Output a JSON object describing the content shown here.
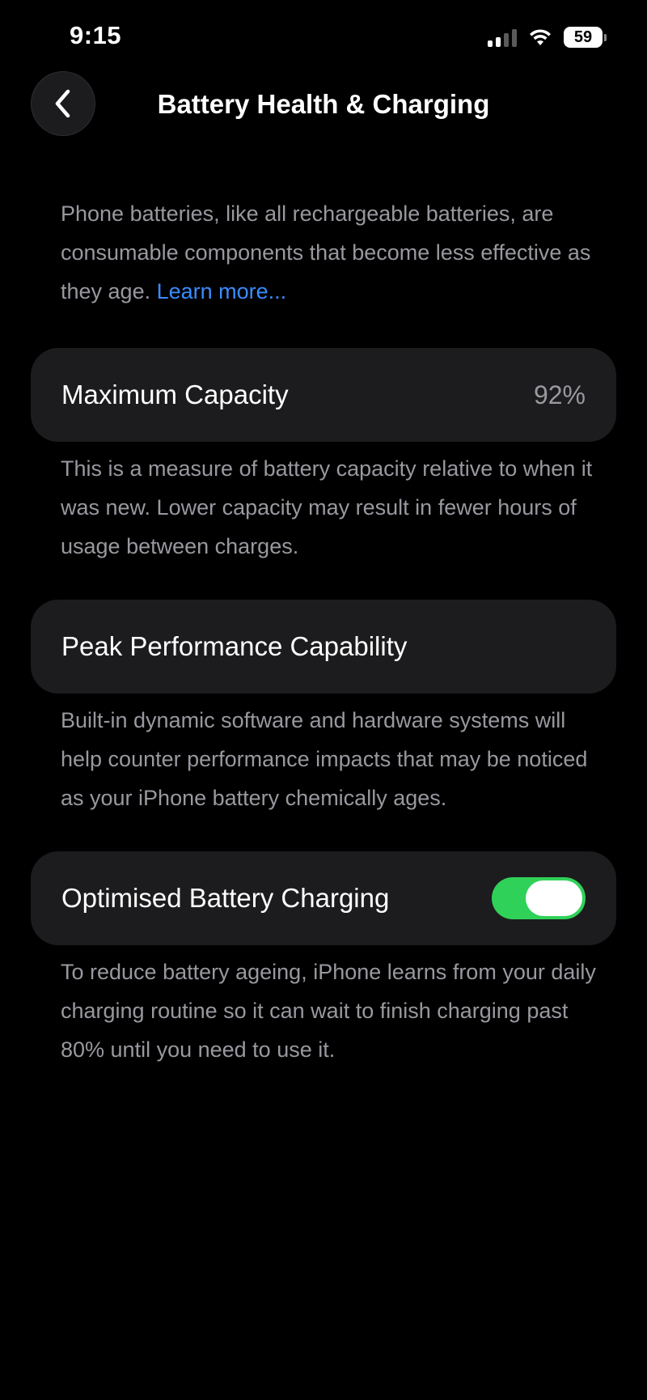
{
  "status_bar": {
    "time": "9:15",
    "battery_level": "59",
    "icons": [
      "cellular-signal-icon",
      "wifi-icon",
      "battery-icon"
    ]
  },
  "nav": {
    "back_icon": "chevron-left-icon",
    "title": "Battery Health & Charging"
  },
  "intro": {
    "text": "Phone batteries, like all rechargeable batteries, are consumable components that become less effective as they age. ",
    "link_label": "Learn more..."
  },
  "maximum_capacity": {
    "label": "Maximum Capacity",
    "value": "92%",
    "footnote": "This is a measure of battery capacity relative to when it was new. Lower capacity may result in fewer hours of usage between charges."
  },
  "peak_performance": {
    "label": "Peak Performance Capability",
    "footnote": "Built-in dynamic software and hardware systems will help counter performance impacts that may be noticed as your iPhone battery chemically ages."
  },
  "optimised_charging": {
    "label": "Optimised Battery Charging",
    "enabled": true,
    "footnote": "To reduce battery ageing, iPhone learns from your daily charging routine so it can wait to finish charging past 80% until you need to use it."
  },
  "colors": {
    "background": "#000000",
    "card": "#1c1c1e",
    "secondary_text": "#98989f",
    "link": "#3a8cff",
    "toggle_on": "#30d158"
  }
}
